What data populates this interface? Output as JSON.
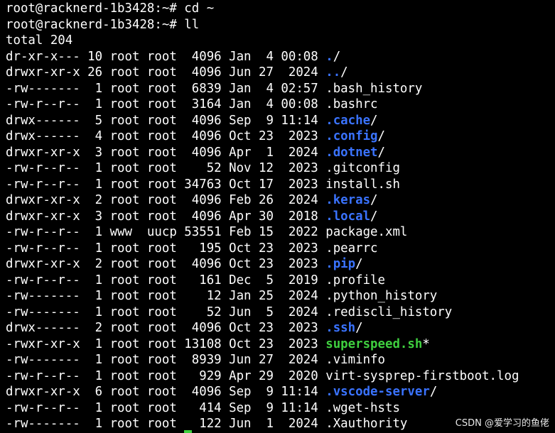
{
  "terminal": {
    "prompt_lines": [
      "root@racknerd-1b3428:~# cd ~",
      "root@racknerd-1b3428:~# ll"
    ],
    "total_line": "total 204",
    "colors": {
      "background": "#000000",
      "text": "#ffffff",
      "directory": "#3a73ff",
      "executable": "#3fcf3f"
    },
    "entries": [
      {
        "meta": "dr-xr-x--- 10 root root  4096 Jan  4 00:08 ",
        "name": ".",
        "type": "dir",
        "suffix": "/"
      },
      {
        "meta": "drwxr-xr-x 26 root root  4096 Jun 27  2024 ",
        "name": "..",
        "type": "dir",
        "suffix": "/"
      },
      {
        "meta": "-rw-------  1 root root  6839 Jan  4 02:57 ",
        "name": ".bash_history",
        "type": "file",
        "suffix": ""
      },
      {
        "meta": "-rw-r--r--  1 root root  3164 Jan  4 00:08 ",
        "name": ".bashrc",
        "type": "file",
        "suffix": ""
      },
      {
        "meta": "drwx------  5 root root  4096 Sep  9 11:14 ",
        "name": ".cache",
        "type": "dir",
        "suffix": "/"
      },
      {
        "meta": "drwx------  4 root root  4096 Oct 23  2023 ",
        "name": ".config",
        "type": "dir",
        "suffix": "/"
      },
      {
        "meta": "drwxr-xr-x  3 root root  4096 Apr  1  2024 ",
        "name": ".dotnet",
        "type": "dir",
        "suffix": "/"
      },
      {
        "meta": "-rw-r--r--  1 root root    52 Nov 12  2023 ",
        "name": ".gitconfig",
        "type": "file",
        "suffix": ""
      },
      {
        "meta": "-rw-r--r--  1 root root 34763 Oct 17  2023 ",
        "name": "install.sh",
        "type": "file",
        "suffix": ""
      },
      {
        "meta": "drwxr-xr-x  2 root root  4096 Feb 26  2024 ",
        "name": ".keras",
        "type": "dir",
        "suffix": "/"
      },
      {
        "meta": "drwxr-xr-x  3 root root  4096 Apr 30  2018 ",
        "name": ".local",
        "type": "dir",
        "suffix": "/"
      },
      {
        "meta": "-rw-r--r--  1 www  uucp 53551 Feb 15  2022 ",
        "name": "package.xml",
        "type": "file",
        "suffix": ""
      },
      {
        "meta": "-rw-r--r--  1 root root   195 Oct 23  2023 ",
        "name": ".pearrc",
        "type": "file",
        "suffix": ""
      },
      {
        "meta": "drwxr-xr-x  2 root root  4096 Oct 23  2023 ",
        "name": ".pip",
        "type": "dir",
        "suffix": "/"
      },
      {
        "meta": "-rw-r--r--  1 root root   161 Dec  5  2019 ",
        "name": ".profile",
        "type": "file",
        "suffix": ""
      },
      {
        "meta": "-rw-------  1 root root    12 Jan 25  2024 ",
        "name": ".python_history",
        "type": "file",
        "suffix": ""
      },
      {
        "meta": "-rw-------  1 root root    52 Jun  5  2024 ",
        "name": ".rediscli_history",
        "type": "file",
        "suffix": ""
      },
      {
        "meta": "drwx------  2 root root  4096 Oct 23  2023 ",
        "name": ".ssh",
        "type": "dir",
        "suffix": "/"
      },
      {
        "meta": "-rwxr-xr-x  1 root root 13108 Oct 23  2023 ",
        "name": "superspeed.sh",
        "type": "exec",
        "suffix": "*"
      },
      {
        "meta": "-rw-------  1 root root  8939 Jun 27  2024 ",
        "name": ".viminfo",
        "type": "file",
        "suffix": ""
      },
      {
        "meta": "-rw-r--r--  1 root root   929 Apr 29  2020 ",
        "name": "virt-sysprep-firstboot.log",
        "type": "file",
        "suffix": ""
      },
      {
        "meta": "drwxr-xr-x  6 root root  4096 Sep  9 11:14 ",
        "name": ".vscode-server",
        "type": "dir",
        "suffix": "/"
      },
      {
        "meta": "-rw-r--r--  1 root root   414 Sep  9 11:14 ",
        "name": ".wget-hsts",
        "type": "file",
        "suffix": ""
      },
      {
        "meta": "-rw-------  1 root root   122 Jun  1  2024 ",
        "name": ".Xauthority",
        "type": "file",
        "suffix": ""
      }
    ]
  },
  "watermark": "CSDN @爱学习的鱼佬"
}
